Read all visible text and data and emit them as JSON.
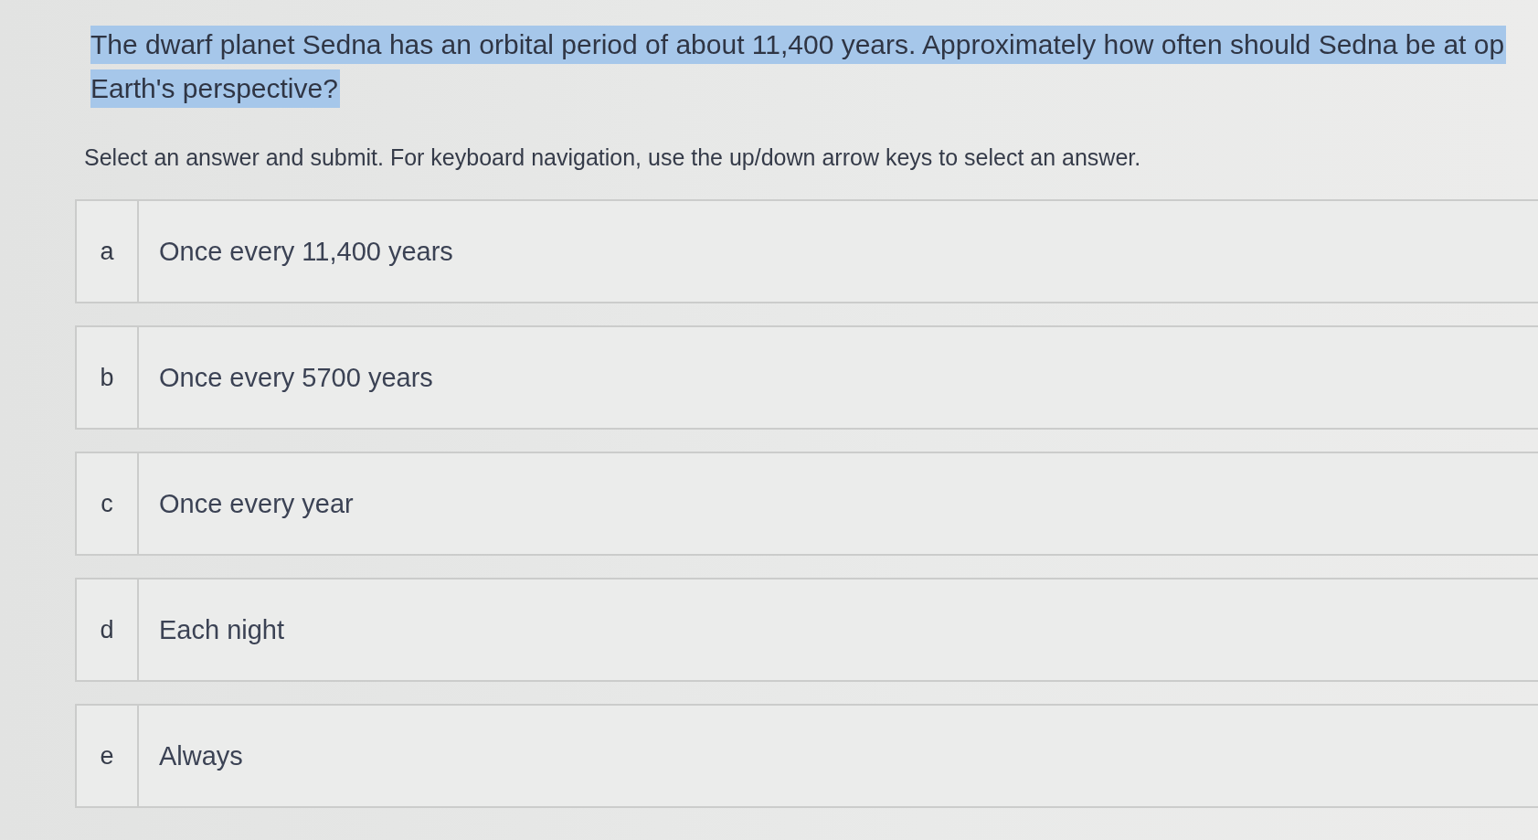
{
  "question": {
    "highlighted": true,
    "lines": [
      "The dwarf planet Sedna has an orbital period of about 11,400 years. Approximately how often should Sedna be at op",
      "Earth's perspective?"
    ]
  },
  "instructions": "Select an answer and submit. For keyboard navigation, use the up/down arrow keys to select an answer.",
  "options": [
    {
      "letter": "a",
      "text": "Once every 11,400 years",
      "selected": false
    },
    {
      "letter": "b",
      "text": "Once every 5700 years",
      "selected": false
    },
    {
      "letter": "c",
      "text": "Once every year",
      "selected": false
    },
    {
      "letter": "d",
      "text": "Each night",
      "selected": false
    },
    {
      "letter": "e",
      "text": "Always",
      "selected": false
    }
  ]
}
